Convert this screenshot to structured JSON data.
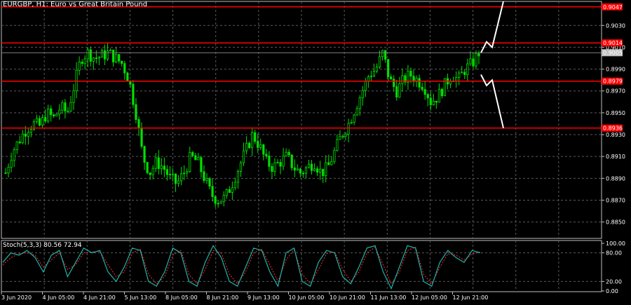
{
  "window": {
    "title": "EURGBP, H1:  Euro vs Great Britain Pound",
    "oscillator_title": "Stoch(5,3,3) 80.56 72.94"
  },
  "colors": {
    "background": "#000000",
    "grid": "#5a5a5a",
    "candle": "#00e000",
    "level_line": "#ff0000",
    "current_price_bg": "#c0c0c0",
    "stoch_main": "#20b2aa",
    "stoch_signal": "#ff3030",
    "projection": "#ffffff"
  },
  "price_axis": {
    "labels": [
      "0.9030",
      "0.9010",
      "0.8990",
      "0.8970",
      "0.8950",
      "0.8930",
      "0.8910",
      "0.8890",
      "0.8870",
      "0.8850"
    ],
    "range": [
      0.8835,
      0.9052
    ]
  },
  "levels": [
    {
      "price": 0.9047,
      "label": "0.9047"
    },
    {
      "price": 0.9014,
      "label": "0.9014"
    },
    {
      "price": 0.8979,
      "label": "0.8979"
    },
    {
      "price": 0.8936,
      "label": "0.8936"
    }
  ],
  "current_price": {
    "price": 0.9005,
    "label": "0.9005"
  },
  "stoch_axis": {
    "labels": [
      "100.00",
      "80.00",
      "20.00",
      "0.00"
    ],
    "values": [
      100,
      80,
      20,
      0
    ]
  },
  "time_axis": {
    "labels": [
      "3 Jun 2020",
      "4 Jun 05:00",
      "4 Jun 21:00",
      "5 Jun 13:00",
      "8 Jun 05:00",
      "8 Jun 21:00",
      "9 Jun 13:00",
      "10 Jun 05:00",
      "10 Jun 21:00",
      "11 Jun 13:00",
      "12 Jun 05:00",
      "12 Jun 21:00"
    ]
  },
  "chart_data": {
    "type": "candlestick",
    "symbol": "EURGBP",
    "timeframe": "H1",
    "close_path": [
      0.8895,
      0.8915,
      0.8925,
      0.8935,
      0.894,
      0.8938,
      0.895,
      0.8945,
      0.8955,
      0.895,
      0.8975,
      0.9,
      0.9005,
      0.9,
      0.9002,
      0.9005,
      0.9,
      0.8995,
      0.898,
      0.895,
      0.891,
      0.8895,
      0.8905,
      0.89,
      0.889,
      0.8885,
      0.8895,
      0.891,
      0.8905,
      0.889,
      0.8875,
      0.887,
      0.8872,
      0.8885,
      0.89,
      0.8915,
      0.893,
      0.892,
      0.8905,
      0.89,
      0.8905,
      0.891,
      0.89,
      0.8895,
      0.89,
      0.8905,
      0.8895,
      0.89,
      0.8915,
      0.893,
      0.894,
      0.8955,
      0.897,
      0.8985,
      0.899,
      0.9005,
      0.898,
      0.897,
      0.898,
      0.8985,
      0.898,
      0.8975,
      0.896,
      0.8965,
      0.8975,
      0.8985,
      0.898,
      0.899,
      0.8995,
      0.9005
    ],
    "projection": {
      "up": [
        0.9005,
        0.9015,
        0.901,
        0.9052
      ],
      "down": [
        0.8985,
        0.8975,
        0.898,
        0.8936
      ]
    },
    "stochastic": {
      "main": [
        60,
        80,
        75,
        85,
        70,
        40,
        75,
        85,
        30,
        60,
        90,
        80,
        85,
        40,
        20,
        50,
        90,
        85,
        20,
        10,
        40,
        90,
        80,
        20,
        10,
        60,
        95,
        70,
        20,
        10,
        50,
        90,
        85,
        40,
        10,
        80,
        90,
        20,
        10,
        60,
        85,
        80,
        30,
        15,
        50,
        90,
        95,
        40,
        5,
        50,
        95,
        90,
        20,
        10,
        60,
        85,
        70,
        60,
        85,
        80
      ],
      "signal": [
        55,
        70,
        78,
        80,
        75,
        50,
        65,
        80,
        45,
        55,
        80,
        82,
        83,
        55,
        30,
        40,
        80,
        87,
        35,
        15,
        30,
        75,
        85,
        35,
        15,
        45,
        85,
        80,
        35,
        15,
        40,
        80,
        87,
        55,
        20,
        65,
        87,
        35,
        15,
        45,
        78,
        82,
        45,
        20,
        40,
        80,
        92,
        55,
        15,
        40,
        85,
        92,
        35,
        15,
        50,
        78,
        75,
        65,
        78,
        82
      ]
    }
  }
}
